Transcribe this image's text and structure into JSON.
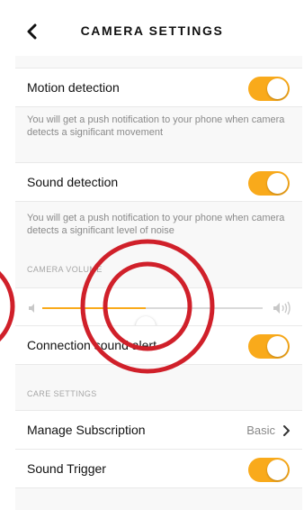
{
  "header": {
    "title": "CAMERA SETTINGS",
    "back_icon": "chevron-left-icon"
  },
  "settings": {
    "motion_detection": {
      "label": "Motion detection",
      "enabled": true,
      "description": "You will get a push notification to your phone when camera detects a significant movement"
    },
    "sound_detection": {
      "label": "Sound detection",
      "enabled": true,
      "description": "You will get a push notification to your phone when camera detects a significant level of noise"
    },
    "camera_volume": {
      "section_label": "CAMERA VOLUME",
      "level": 0.47,
      "low_icon": "volume-low-icon",
      "high_icon": "volume-high-icon"
    },
    "connection_sound_alert": {
      "label": "Connection sound alert",
      "enabled": true
    },
    "care_settings": {
      "section_label": "CARE SETTINGS"
    },
    "manage_subscription": {
      "label": "Manage Subscription",
      "value": "Basic",
      "chevron_icon": "chevron-right-icon"
    },
    "sound_trigger": {
      "label": "Sound Trigger",
      "enabled": true
    }
  },
  "colors": {
    "accent": "#f9aa1b",
    "annotation_red": "#d0202a",
    "background": "#f8f8f8"
  }
}
